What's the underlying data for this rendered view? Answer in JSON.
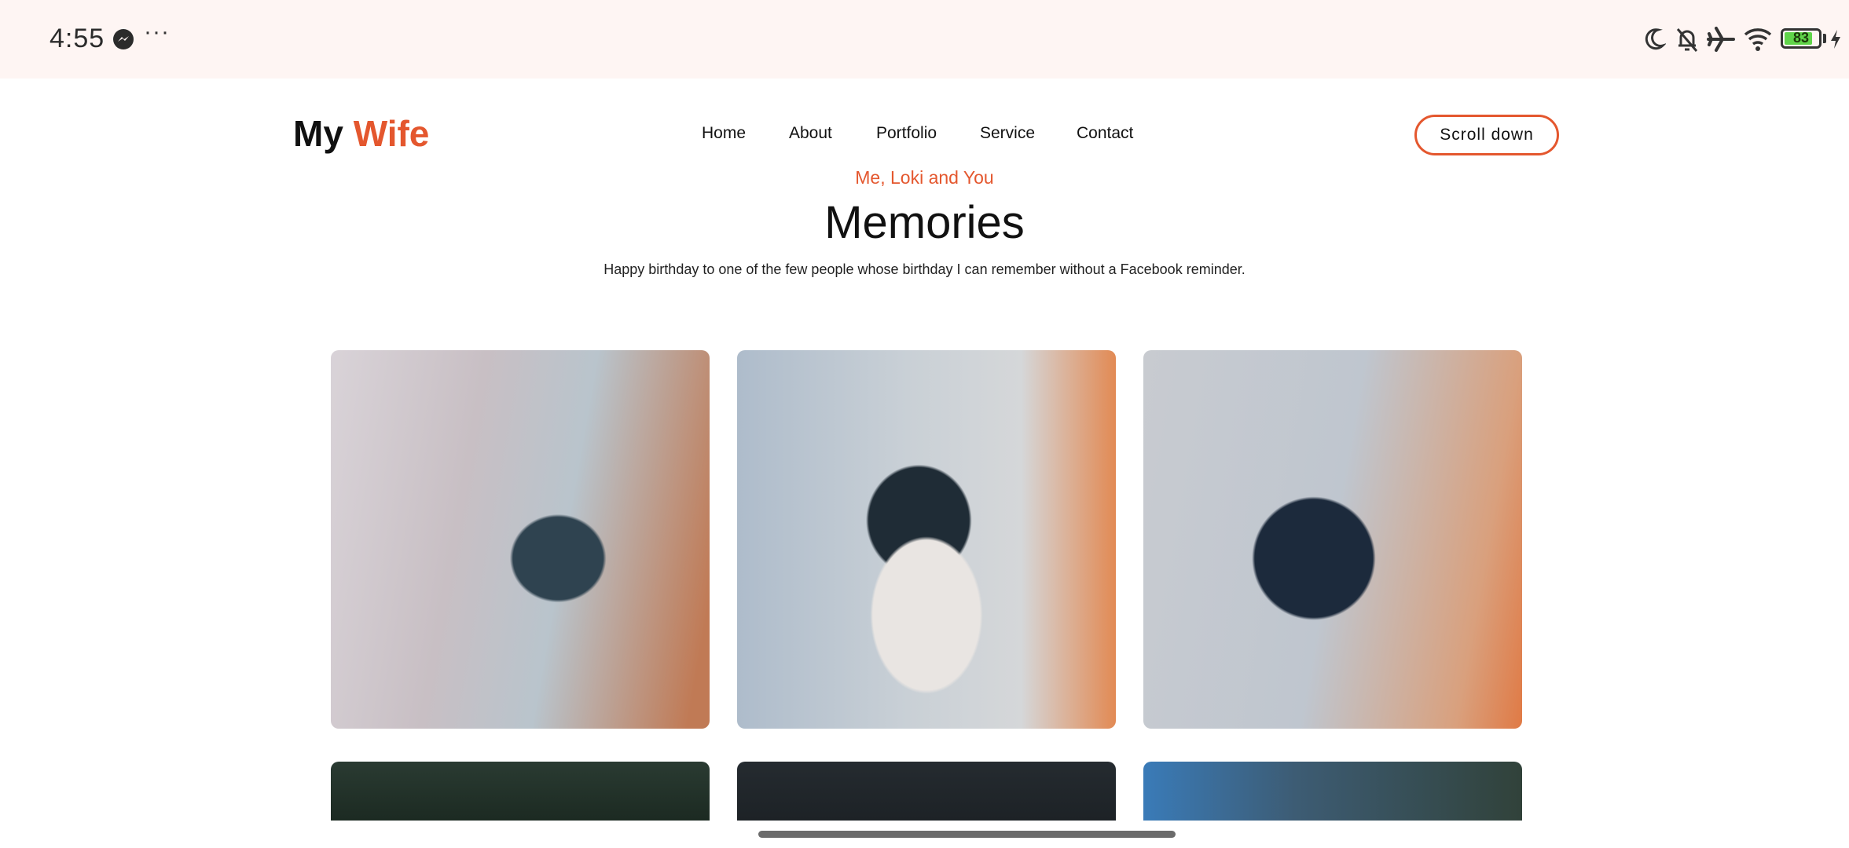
{
  "status_bar": {
    "time": "4:55",
    "more": "···",
    "battery_level": "83",
    "battery_fraction": 0.83,
    "icons": [
      "messenger-icon",
      "moon-icon",
      "bell-off-icon",
      "airplane-icon",
      "wifi-icon",
      "battery-icon",
      "charging-icon"
    ]
  },
  "header": {
    "logo_main": "My",
    "logo_accent": "Wife",
    "nav": [
      "Home",
      "About",
      "Portfolio",
      "Service",
      "Contact"
    ],
    "cta_label": "Scroll down"
  },
  "hero": {
    "subtitle": "Me, Loki and You",
    "title": "Memories",
    "description": "Happy birthday to one of the few people whose birthday I can remember without a Facebook reminder."
  },
  "colors": {
    "accent": "#e4572e",
    "status_bar_bg": "#fef5f3",
    "text": "#111111"
  }
}
